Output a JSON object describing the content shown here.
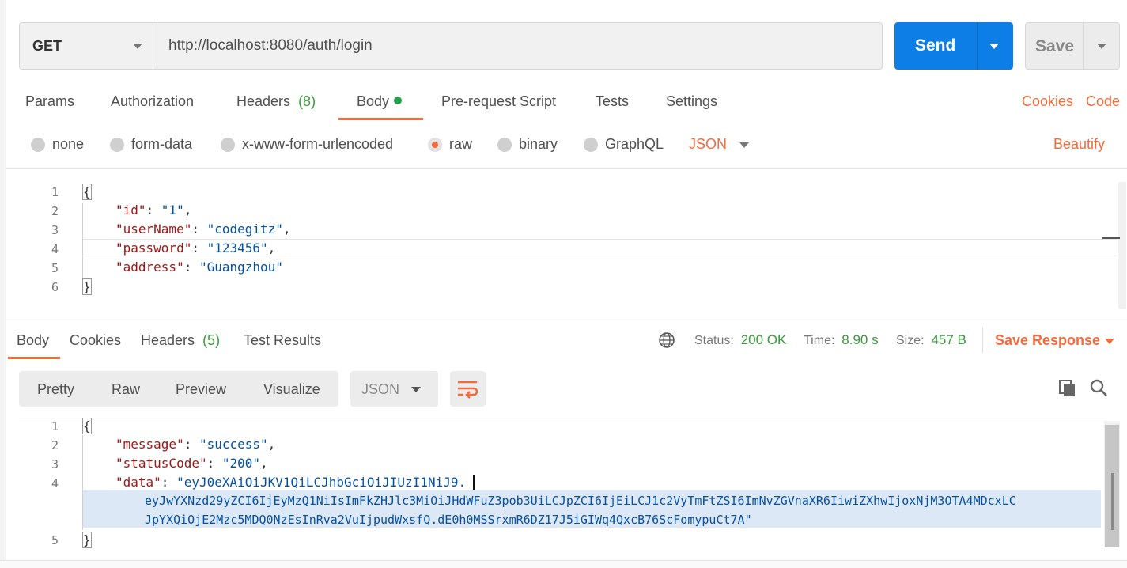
{
  "request": {
    "method": "GET",
    "url": "http://localhost:8080/auth/login",
    "send_label": "Send",
    "save_label": "Save"
  },
  "request_tabs": {
    "params": "Params",
    "authorization": "Authorization",
    "headers": "Headers",
    "headers_count": "(8)",
    "body": "Body",
    "pre_request": "Pre-request Script",
    "tests": "Tests",
    "settings": "Settings",
    "active": "Body",
    "cookies": "Cookies",
    "code": "Code"
  },
  "body_modes": {
    "none": "none",
    "form_data": "form-data",
    "urlencoded": "x-www-form-urlencoded",
    "raw": "raw",
    "binary": "binary",
    "graphql": "GraphQL",
    "selected": "raw",
    "raw_type": "JSON",
    "beautify": "Beautify"
  },
  "request_body": {
    "line_numbers": [
      "1",
      "2",
      "3",
      "4",
      "5",
      "6"
    ],
    "open_brace": "{",
    "close_brace": "}",
    "fields": [
      {
        "key": "\"id\"",
        "value": "\"1\"",
        "sep": ","
      },
      {
        "key": "\"userName\"",
        "value": "\"codegitz\"",
        "sep": ","
      },
      {
        "key": "\"password\"",
        "value": "\"123456\"",
        "sep": ","
      },
      {
        "key": "\"address\"",
        "value": "\"Guangzhou\"",
        "sep": ""
      }
    ]
  },
  "response_tabs": {
    "body": "Body",
    "cookies": "Cookies",
    "headers": "Headers",
    "headers_count": "(5)",
    "test_results": "Test Results",
    "active": "Body"
  },
  "response_meta": {
    "status_label": "Status:",
    "status_value": "200 OK",
    "time_label": "Time:",
    "time_value": "8.90 s",
    "size_label": "Size:",
    "size_value": "457 B",
    "save_response": "Save Response"
  },
  "response_view": {
    "pretty": "Pretty",
    "raw": "Raw",
    "preview": "Preview",
    "visualize": "Visualize",
    "format": "JSON"
  },
  "response_body": {
    "line_numbers": [
      "1",
      "2",
      "3",
      "4",
      "",
      "",
      "5"
    ],
    "open_brace": "{",
    "close_brace": "}",
    "message_key": "\"message\"",
    "message_value": "\"success\"",
    "status_key": "\"statusCode\"",
    "status_value": "\"200\"",
    "data_key": "\"data\"",
    "data_line1": "\"eyJ0eXAiOiJKV1QiLCJhbGciOiJIUzI1NiJ9.",
    "data_line2": "eyJwYXNzd29yZCI6IjEyMzQ1NiIsImFkZHJlc3MiOiJHdWFuZ3pob3UiLCJpZCI6IjEiLCJ1c2VyTmFtZSI6ImNvZGVnaXR6IiwiZXhwIjoxNjM3OTA4MDcxLC",
    "data_line3": "JpYXQiOjE2Mzc5MDQ0NzEsInRva2VuIjpudWxsfQ.dE0h0MSSrxmR6DZ17J5iGIWq4QxcB76ScFomypuCt7A\""
  },
  "colors": {
    "accent": "#f26b3a",
    "send_blue": "#0d7ee6",
    "success_green": "#3c9a3c",
    "json_key": "#a31515",
    "json_string": "#0451a5"
  },
  "icons": {
    "globe": "globe-icon",
    "copy": "copy-icon",
    "search": "search-icon",
    "wrap": "wrap-lines-icon"
  }
}
